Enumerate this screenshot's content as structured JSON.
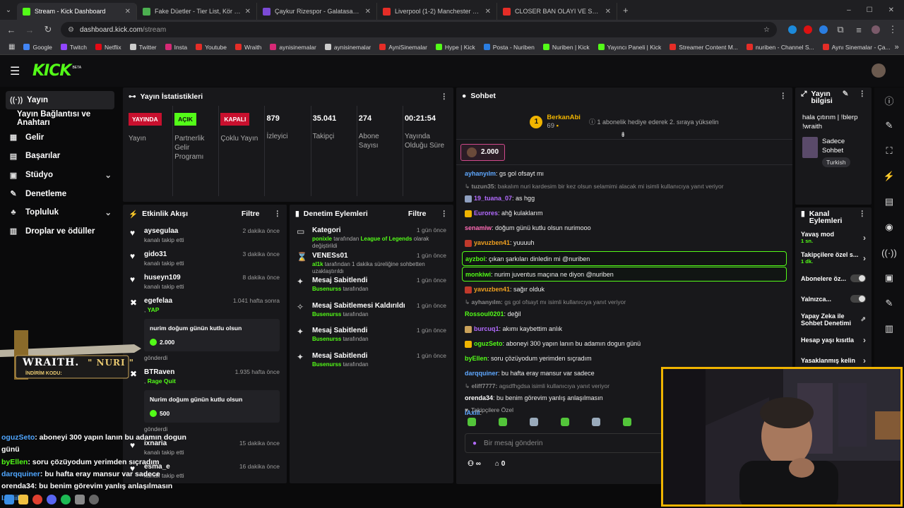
{
  "browser": {
    "tabs": [
      {
        "title": "Stream - Kick Dashboard",
        "color": "#53fc18",
        "active": true
      },
      {
        "title": "Fake Düetler - Tier List, Kör Sıra",
        "color": "#4caf50",
        "active": false
      },
      {
        "title": "Çaykur Rizespor - Galatasaray | Ma",
        "color": "#7b4ad6",
        "active": false
      },
      {
        "title": "Liverpool (1-2) Manchester City",
        "color": "#e52d27",
        "active": false
      },
      {
        "title": "CLOSER BAN OLAYI VE SONRAS",
        "color": "#e52d27",
        "active": false
      }
    ],
    "url_domain": "dashboard.kick.com",
    "url_path": "/stream",
    "bookmarks": [
      {
        "label": "Google",
        "color": "#4285f4"
      },
      {
        "label": "Twitch",
        "color": "#9146ff"
      },
      {
        "label": "Netflix",
        "color": "#e50914"
      },
      {
        "label": "Twitter",
        "color": "#cccccc"
      },
      {
        "label": "Insta",
        "color": "#d62976"
      },
      {
        "label": "Youtube",
        "color": "#e52d27"
      },
      {
        "label": "Wraith",
        "color": "#e52d27"
      },
      {
        "label": "aynisinemalar",
        "color": "#d62976"
      },
      {
        "label": "aynisinemalar",
        "color": "#cccccc"
      },
      {
        "label": "AyniSinemalar",
        "color": "#e52d27"
      },
      {
        "label": "Hype | Kick",
        "color": "#53fc18"
      },
      {
        "label": "Posta - Nuriben",
        "color": "#2a7de1"
      },
      {
        "label": "Nuriben | Kick",
        "color": "#53fc18"
      },
      {
        "label": "Yayıncı Paneli | Kick",
        "color": "#53fc18"
      },
      {
        "label": "Streamer Content M...",
        "color": "#e52d27"
      },
      {
        "label": "nuriben - Channel S...",
        "color": "#e52d27"
      },
      {
        "label": "Aynı Sinemalar - Ça...",
        "color": "#e52d27"
      }
    ]
  },
  "brand": {
    "logo": "KICK",
    "beta": "BETA",
    "accent": "#53fc18"
  },
  "sidebar": {
    "items": [
      {
        "label": "Yayın",
        "icon": "broadcast-icon",
        "glyph": "((·))",
        "active": true,
        "chevron": false,
        "sub": false
      },
      {
        "label": "Yayın Bağlantısı ve Anahtarı",
        "icon": "",
        "glyph": "",
        "active": false,
        "chevron": false,
        "sub": true
      },
      {
        "label": "Gelir",
        "icon": "revenue-icon",
        "glyph": "▦",
        "active": false,
        "chevron": false,
        "sub": false
      },
      {
        "label": "Başarılar",
        "icon": "achievements-icon",
        "glyph": "▤",
        "active": false,
        "chevron": false,
        "sub": false
      },
      {
        "label": "Stüdyo",
        "icon": "studio-icon",
        "glyph": "▣",
        "active": false,
        "chevron": true,
        "sub": false
      },
      {
        "label": "Denetleme",
        "icon": "wrench-icon",
        "glyph": "✎",
        "active": false,
        "chevron": false,
        "sub": false
      },
      {
        "label": "Topluluk",
        "icon": "community-icon",
        "glyph": "♣",
        "active": false,
        "chevron": true,
        "sub": false
      },
      {
        "label": "Droplar ve ödüller",
        "icon": "drops-icon",
        "glyph": "▥",
        "active": false,
        "chevron": false,
        "sub": false
      }
    ]
  },
  "stats": {
    "title": "Yayın İstatistikleri",
    "cells": [
      {
        "badge": "YAYINDA",
        "badge_color": "red",
        "value": "",
        "label": "Yayın"
      },
      {
        "badge": "AÇIK",
        "badge_color": "green",
        "value": "",
        "label": "Partnerlik Gelir Programı"
      },
      {
        "badge": "KAPALI",
        "badge_color": "red",
        "value": "",
        "label": "Çoklu Yayın"
      },
      {
        "badge": "",
        "badge_color": "",
        "value": "879",
        "label": "İzleyici"
      },
      {
        "badge": "",
        "badge_color": "",
        "value": "35.041",
        "label": "Takipçi"
      },
      {
        "badge": "",
        "badge_color": "",
        "value": "274",
        "label": "Abone Sayısı"
      },
      {
        "badge": "",
        "badge_color": "",
        "value": "00:21:54",
        "label": "Yayında Olduğu Süre"
      }
    ]
  },
  "events": {
    "title": "Etkinlik Akışı",
    "filter": "Filtre",
    "items": [
      {
        "name": "aysegulaa",
        "time": "2 dakika önce",
        "sub": "kanalı takip etti",
        "icon": "♥",
        "extra": "",
        "box": "",
        "coin": "",
        "after": ""
      },
      {
        "name": "gido31",
        "time": "3 dakika önce",
        "sub": "kanalı takip etti",
        "icon": "♥",
        "extra": "",
        "box": "",
        "coin": "",
        "after": ""
      },
      {
        "name": "huseyn109",
        "time": "8 dakika önce",
        "sub": "kanalı takip etti",
        "icon": "♥",
        "extra": "",
        "box": "",
        "coin": "",
        "after": ""
      },
      {
        "name": "egefelaa",
        "time": "1.041 hafta sonra",
        "sub": ",",
        "icon": "✖",
        "extra": "YAP",
        "box": "nurim doğum günün kutlu olsun",
        "coin": "2.000",
        "after": "gönderdi"
      },
      {
        "name": "BTRaven",
        "time": "1.935 hafta önce",
        "sub": ",",
        "icon": "✖",
        "extra": "Rage Quit",
        "box": "Nurim doğum günün kutlu olsun",
        "coin": "500",
        "after": "gönderdi"
      },
      {
        "name": "ixnaria",
        "time": "15 dakika önce",
        "sub": "kanalı takip etti",
        "icon": "♥",
        "extra": "",
        "box": "",
        "coin": "",
        "after": ""
      },
      {
        "name": "esma_e",
        "time": "16 dakika önce",
        "sub": "kanalı takip etti",
        "icon": "♥",
        "extra": "",
        "box": "",
        "coin": "",
        "after": ""
      }
    ]
  },
  "moderation": {
    "title": "Denetim Eylemleri",
    "filter": "Filtre",
    "items": [
      {
        "title": "Kategori",
        "time": "1 gün önce",
        "icon": "▭",
        "pre": "ponixle",
        "mid": " tarafından ",
        "green2": "League of Legends",
        "post": " olarak değiştirildi"
      },
      {
        "title": "VENESs01",
        "time": "1 gün önce",
        "icon": "⌛",
        "pre": "al1k",
        "mid": " tarafından 1 dakika süreliğine sohbetten uzaklaştırıldı",
        "green2": "",
        "post": ""
      },
      {
        "title": "Mesaj Sabitlendi",
        "time": "1 gün önce",
        "icon": "✦",
        "pre": "Busenurss",
        "mid": " tarafından",
        "green2": "",
        "post": ""
      },
      {
        "title": "Mesaj Sabitlemesi Kaldırıldı",
        "time": "1 gün önce",
        "icon": "✧",
        "pre": "Busenurss",
        "mid": " tarafından",
        "green2": "",
        "post": ""
      },
      {
        "title": "Mesaj Sabitlendi",
        "time": "1 gün önce",
        "icon": "✦",
        "pre": "Busenurss",
        "mid": " tarafından",
        "green2": "",
        "post": ""
      },
      {
        "title": "Mesaj Sabitlendi",
        "time": "1 gün önce",
        "icon": "✦",
        "pre": "Busenurss",
        "mid": " tarafından",
        "green2": "",
        "post": ""
      }
    ]
  },
  "chat": {
    "title": "Sohbet",
    "top_user": "BerkanAbi",
    "top_count": "69",
    "top_badge": "1",
    "top_text": "1 abonelik hediye ederek 2. sıraya yükselin",
    "pinned_amount": "2.000",
    "messages": [
      {
        "type": "msg",
        "name": "ayhanyılm",
        "color": "#5fa8ff",
        "text": ": gs gol ofsayt mı",
        "badges": ""
      },
      {
        "type": "reply",
        "name": "tuzun35:",
        "color": "#8a8a8a",
        "text": " bakalım nuri kardesim bir kez olsun selamimi alacak mi isimli kullanıcıya yanıt veriyor",
        "badges": ""
      },
      {
        "type": "msg",
        "name": "19_tuana_07",
        "color": "#b36bff",
        "text": ": as hgg",
        "badges": "#8fa0c0"
      },
      {
        "type": "msg",
        "name": "Eurores",
        "color": "#b36bff",
        "text": ": ahğ kulaklarım",
        "badges": "#f0b400"
      },
      {
        "type": "msg",
        "name": "senamiw",
        "color": "#ff6bb5",
        "text": ": doğum günü kutlu olsun nurimooo",
        "badges": ""
      },
      {
        "type": "msg",
        "name": "yavuzben41",
        "color": "#f0a020",
        "text": ": yuuuuh",
        "badges": "#c0392b"
      },
      {
        "type": "hl",
        "name": "ayzboi",
        "color": "#53fc18",
        "text": ": çıkan şarkıları dinledin mi @nuriben",
        "badges": ""
      },
      {
        "type": "hl",
        "name": "monkiwi",
        "color": "#53fc18",
        "text": ": nurim juventus maçına ne diyon @nuriben",
        "badges": ""
      },
      {
        "type": "msg",
        "name": "yavuzben41",
        "color": "#f0a020",
        "text": ": sağır olduk",
        "badges": "#c0392b"
      },
      {
        "type": "reply",
        "name": "ayhanyılm:",
        "color": "#8a8a8a",
        "text": " gs gol ofsayt mı isimli kullanıcıya yanıt veriyor",
        "badges": ""
      },
      {
        "type": "msg",
        "name": "Rossoul0201",
        "color": "#53fc18",
        "text": ": değil",
        "badges": ""
      },
      {
        "type": "msg",
        "name": "burcuq1",
        "color": "#b36bff",
        "text": ": akımı kaybettim anlık",
        "badges": "#c9a15a"
      },
      {
        "type": "msg",
        "name": "oguzSeto",
        "color": "#53fc18",
        "text": ": aboneyi 300 yapın lanın bu adamın dogun günü",
        "badges": "#f0b400"
      },
      {
        "type": "msg",
        "name": "byEllen",
        "color": "#53fc18",
        "text": ": soru çözüyodum yerimden sıçradım",
        "badges": ""
      },
      {
        "type": "msg",
        "name": "darqquiner",
        "color": "#5fa8ff",
        "text": ": bu hafta eray mansur var sadece",
        "badges": ""
      },
      {
        "type": "reply",
        "name": "eliff7777:",
        "color": "#8a8a8a",
        "text": " agsdfhgdsa isimli kullanıcıya yanıt veriyor",
        "badges": ""
      },
      {
        "type": "msg",
        "name": "orenda34",
        "color": "#ffffff",
        "text": ": bu benim görevim yanlış anlaşılmasın",
        "badges": ""
      },
      {
        "type": "msg",
        "name": "IAxiil",
        "color": "#5fa8ff",
        "text": ":",
        "badges": ""
      }
    ],
    "follower_only": "Takipçilere Özel",
    "input_placeholder": "Bir mesaj gönderin",
    "footer_count": "0"
  },
  "stream_info": {
    "title": "Yayın bilgisi",
    "stream_title": "hala çıtırım | !blerp !wraith",
    "category": "Sadece Sohbet",
    "language": "Turkish"
  },
  "channel_actions": {
    "title": "Kanal Eylemleri",
    "items": [
      {
        "label": "Yavaş mod",
        "sub": "1 sn.",
        "control": "chevron"
      },
      {
        "label": "Takipçilere özel s...",
        "sub": "1 dk.",
        "control": "chevron"
      },
      {
        "label": "Abonelere öz...",
        "sub": "",
        "control": "toggle"
      },
      {
        "label": "Yalnızca...",
        "sub": "",
        "control": "toggle"
      },
      {
        "label": "Yapay Zeka ile Sohbet Denetimi",
        "sub": "",
        "control": "external"
      },
      {
        "label": "Hesap yaşı kısıtla",
        "sub": "",
        "control": "chevron"
      },
      {
        "label": "Yasaklanmış kelin",
        "sub": "",
        "control": "chevron"
      }
    ]
  },
  "overlay": {
    "brand": "WRAITH.",
    "code_label": "İNDİRİM KODU:",
    "code": "\" NURI \"",
    "chat": [
      {
        "name": "oguzSeto",
        "color": "#4fa6ff",
        "text": ": aboneyi 300 yapın lanın bu adamın dogun günü"
      },
      {
        "name": "byEllen",
        "color": "#53fc18",
        "text": ": soru çözüyodum yerimden sıçradım"
      },
      {
        "name": "darqquiner",
        "color": "#4fa6ff",
        "text": ": bu hafta eray mansur var sadece"
      },
      {
        "name": "orenda34",
        "color": "#ffffff",
        "text": ": bu benim görevim yanlış anlaşılmasın"
      },
      {
        "name": "IAxiil",
        "color": "#4fa6ff",
        "text": ":"
      }
    ]
  }
}
